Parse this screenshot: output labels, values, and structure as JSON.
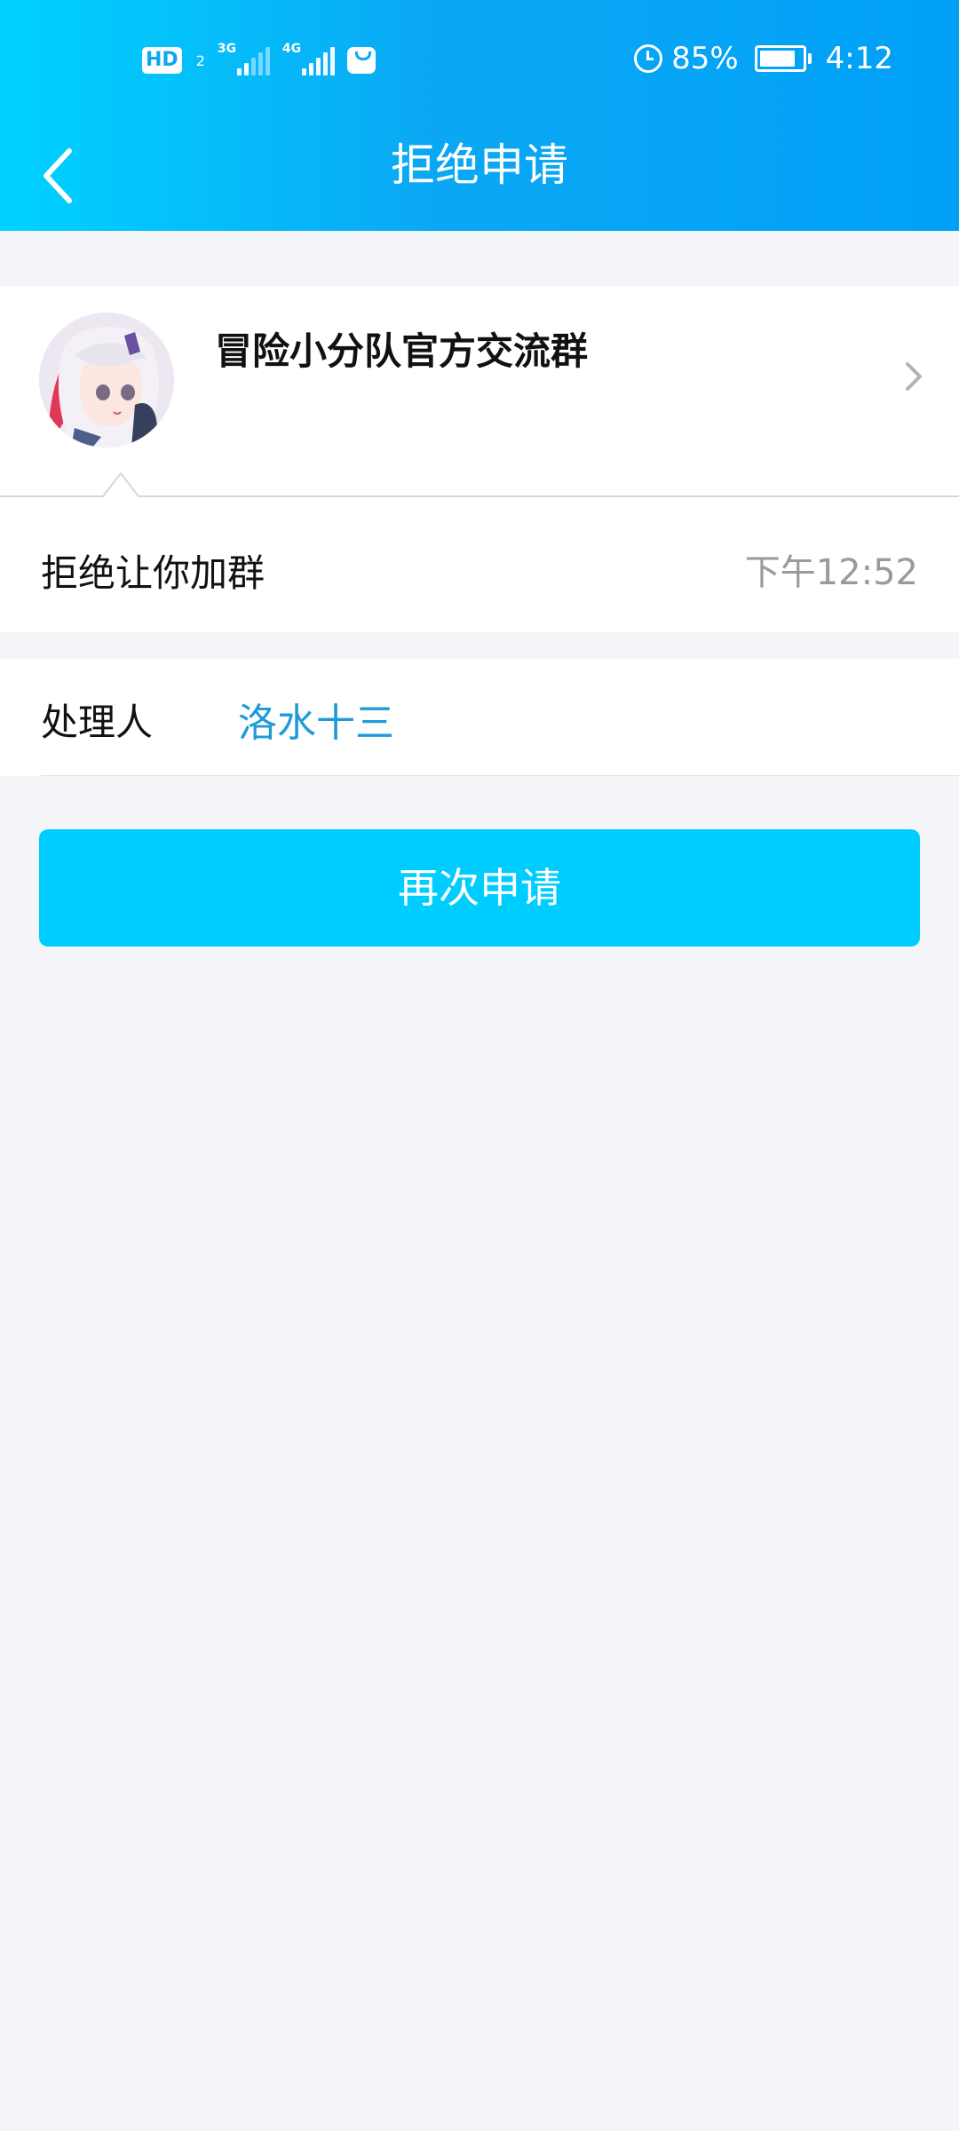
{
  "status_bar": {
    "hd_label": "HD",
    "hd_sub": "2",
    "network_1": "3G",
    "network_2": "4G",
    "battery_percent": "85%",
    "battery_level": 0.85,
    "time": "4:12"
  },
  "nav": {
    "title": "拒绝申请",
    "back_icon": "chevron-left-icon"
  },
  "group": {
    "name": "冒险小分队官方交流群",
    "chevron_icon": "chevron-right-icon"
  },
  "request": {
    "status_text": "拒绝让你加群",
    "time": "下午12:52"
  },
  "handler": {
    "label": "处理人",
    "name": "洛水十三"
  },
  "actions": {
    "reapply_label": "再次申请"
  },
  "colors": {
    "header_start": "#00d2ff",
    "header_end": "#00a0f7",
    "button": "#00cdff",
    "handler_link": "#1e9ad6",
    "background": "#f4f5f9"
  }
}
